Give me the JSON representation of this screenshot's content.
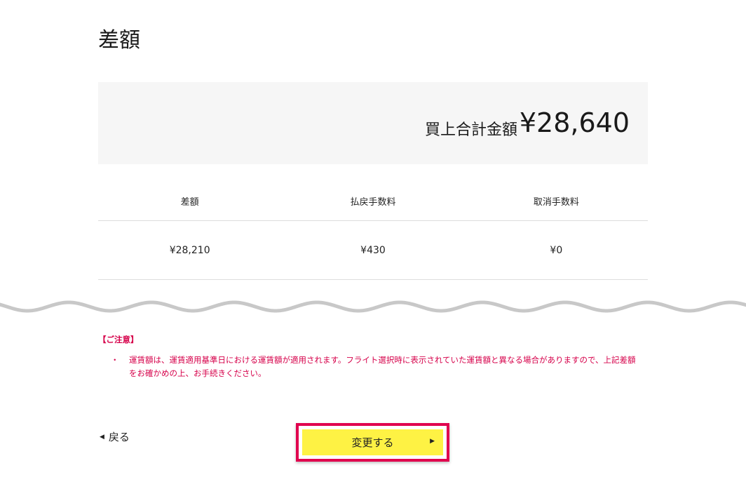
{
  "page": {
    "title": "差額"
  },
  "total": {
    "label": "買上合計金額",
    "value": "¥28,640"
  },
  "breakdown": {
    "headers": [
      "差額",
      "払戻手数料",
      "取消手数料"
    ],
    "values": [
      "¥28,210",
      "¥430",
      "¥0"
    ]
  },
  "notice": {
    "title": "【ご注意】",
    "bullet": "・",
    "items": [
      "運賃額は、運賃適用基準日における運賃額が適用されます。フライト選択時に表示されていた運賃額と異なる場合がありますので、上記差額をお確かめの上、お手続きください。"
    ]
  },
  "actions": {
    "back_label": "戻る",
    "back_icon": "caret-left-icon",
    "submit_label": "変更する",
    "submit_icon": "caret-right-icon"
  },
  "colors": {
    "notice": "#d6004a",
    "button_fill": "#fef244",
    "button_outline": "#e0004e",
    "panel_bg": "#f6f6f6",
    "wave": "#c8c8c8"
  }
}
